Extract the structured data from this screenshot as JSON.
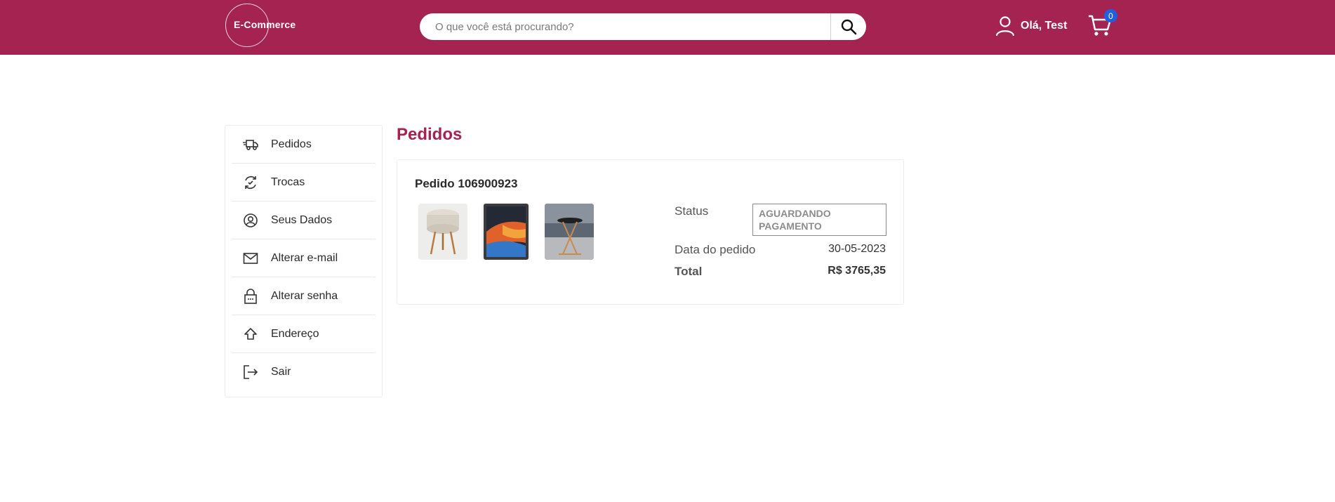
{
  "header": {
    "logo_text": "E-Commerce",
    "search_placeholder": "O que você está procurando?",
    "account_label": "Olá, Test",
    "cart_count": "0",
    "brand_color": "#a52350",
    "badge_color": "#1f5fe0"
  },
  "sidebar": {
    "items": [
      {
        "label": "Pedidos",
        "icon": "truck-icon"
      },
      {
        "label": "Trocas",
        "icon": "exchange-icon"
      },
      {
        "label": "Seus Dados",
        "icon": "user-circle-icon"
      },
      {
        "label": "Alterar e-mail",
        "icon": "envelope-icon"
      },
      {
        "label": "Alterar senha",
        "icon": "lock-icon"
      },
      {
        "label": "Endereço",
        "icon": "home-icon"
      },
      {
        "label": "Sair",
        "icon": "logout-icon"
      }
    ]
  },
  "main": {
    "title": "Pedidos",
    "order": {
      "number": "Pedido 106900923",
      "products": [
        {
          "name": "stool-product-image"
        },
        {
          "name": "tablet-product-image"
        },
        {
          "name": "side-table-product-image"
        }
      ],
      "status_label": "Status",
      "status_value": "AGUARDANDO PAGAMENTO",
      "date_label": "Data do pedido",
      "date_value": "30-05-2023",
      "total_label": "Total",
      "total_value": "R$ 3765,35"
    }
  }
}
